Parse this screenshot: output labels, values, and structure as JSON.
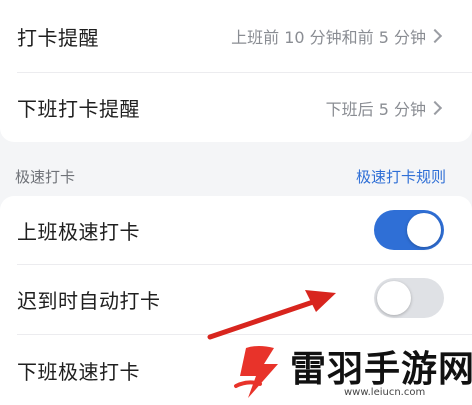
{
  "reminders": [
    {
      "label": "打卡提醒",
      "value": "上班前 10 分钟和前 5 分钟"
    },
    {
      "label": "下班打卡提醒",
      "value": "下班后 5 分钟"
    }
  ],
  "section": {
    "title": "极速打卡",
    "link": "极速打卡规则"
  },
  "settings": [
    {
      "label": "上班极速打卡",
      "enabled": true
    },
    {
      "label": "迟到时自动打卡",
      "enabled": false
    },
    {
      "label": "下班极速打卡"
    }
  ],
  "colors": {
    "accent": "#2f6fd6",
    "toggle_off": "#dfe1e5",
    "arrow": "#d8251e",
    "logo_red": "#e8332a"
  },
  "watermark": {
    "brand": "雷羽手游网",
    "url": "www.leiucn.com",
    "logo_icon": "lightning-logo-icon"
  }
}
